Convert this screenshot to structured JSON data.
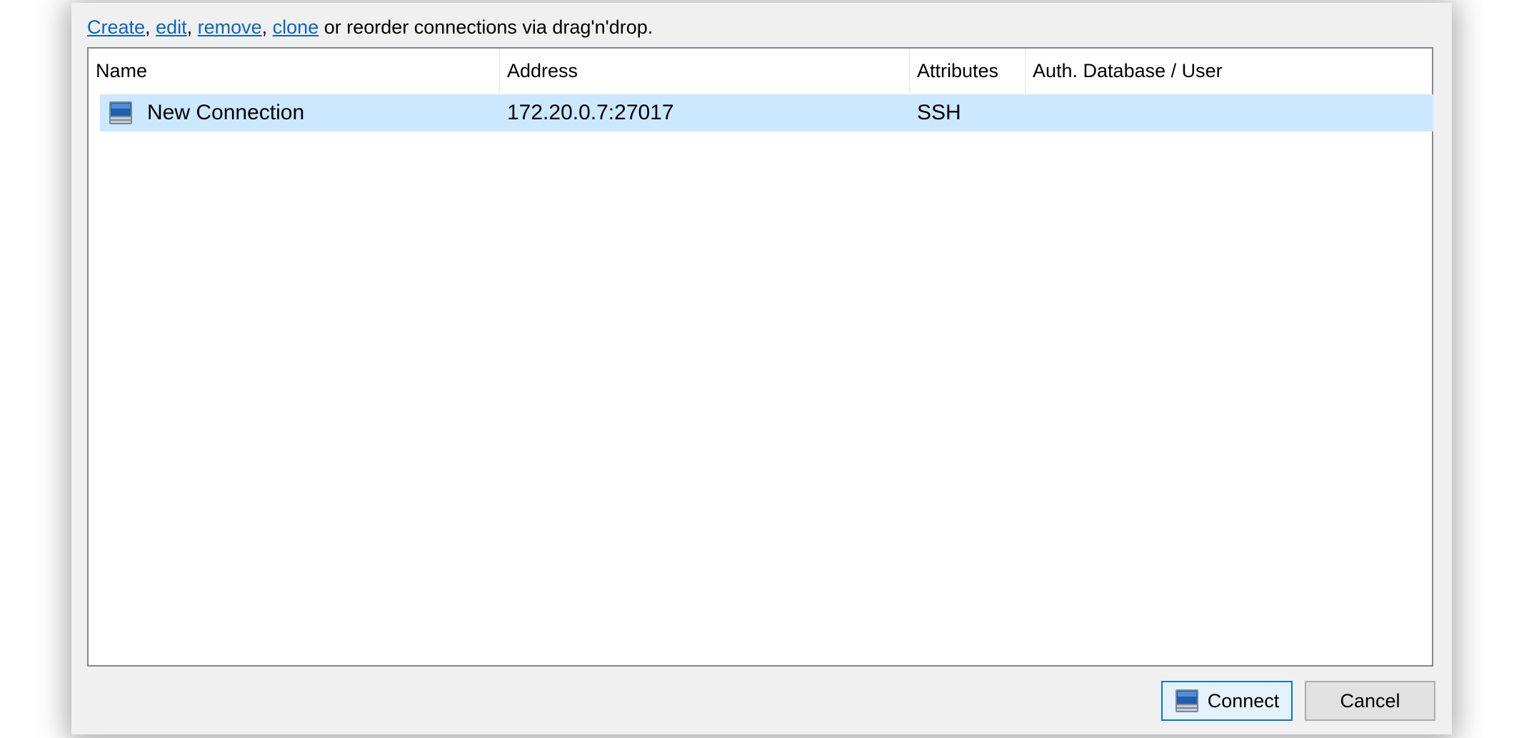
{
  "instructions": {
    "create_link": "Create",
    "sep1": ", ",
    "edit_link": "edit",
    "sep2": ", ",
    "remove_link": "remove",
    "sep3": ", ",
    "clone_link": "clone",
    "rest": " or reorder connections via drag'n'drop."
  },
  "table": {
    "columns": [
      "Name",
      "Address",
      "Attributes",
      "Auth. Database / User"
    ],
    "rows": [
      {
        "icon": "computer-icon",
        "name": "New Connection",
        "address": "172.20.0.7:27017",
        "attributes": "SSH",
        "auth": ""
      }
    ]
  },
  "buttons": {
    "connect": "Connect",
    "cancel": "Cancel"
  },
  "colors": {
    "link": "#0b65c2",
    "selection": "#cce8ff",
    "default_button_border": "#0078d7"
  }
}
